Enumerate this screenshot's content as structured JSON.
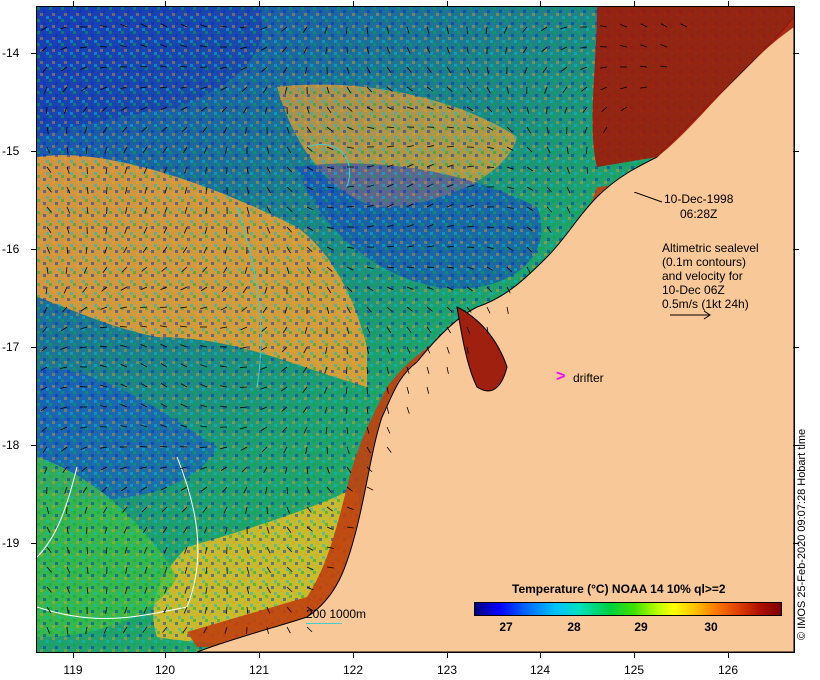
{
  "map": {
    "type": "sea surface temperature satellite image",
    "timestamp_line1": "10-Dec-1998",
    "timestamp_line2": "06:28Z",
    "info_lines": [
      "Altimetric sealevel",
      "(0.1m contours)",
      "and velocity for",
      "10-Dec 06Z",
      "0.5m/s (1kt 24h)"
    ],
    "drifter_label": "drifter",
    "drifter_symbol": ">",
    "scale_label": "200  1000m",
    "credit": "© IMOS 25-Feb-2020 09:07:28 Hobart time",
    "colors": {
      "land": "#f8c898",
      "drifter": "#ff00ff",
      "depth_contour": "#44cccc"
    }
  },
  "axes": {
    "y_ticks": [
      "-14",
      "-15",
      "-16",
      "-17",
      "-18",
      "-19"
    ],
    "x_ticks": [
      "119",
      "120",
      "121",
      "122",
      "123",
      "124",
      "125",
      "126"
    ]
  },
  "legend": {
    "title": "Temperature (°C) NOAA 14 10% ql>=2",
    "labels": [
      "27",
      "28",
      "29",
      "30"
    ]
  }
}
